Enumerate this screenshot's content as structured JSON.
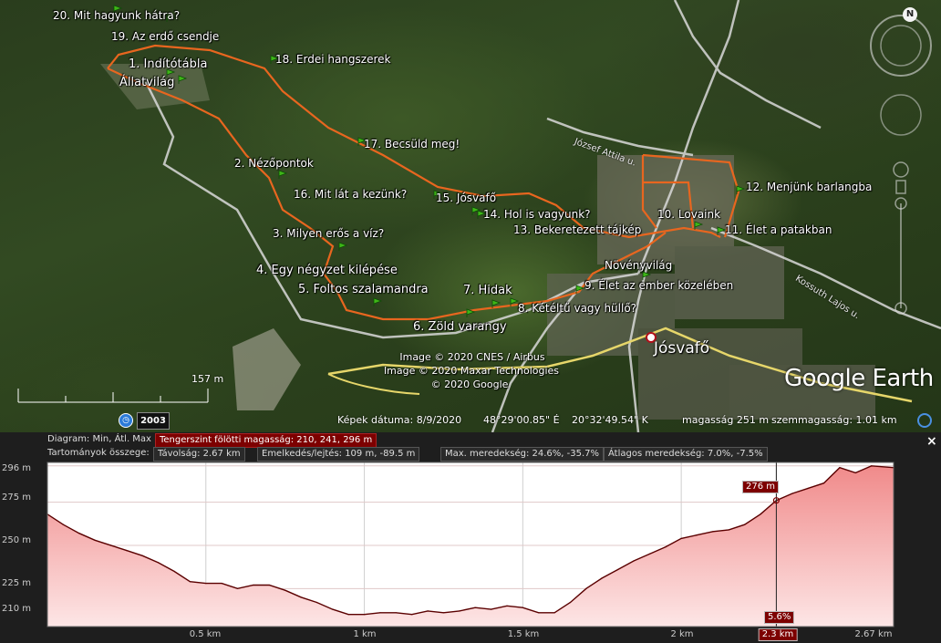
{
  "map": {
    "stations": [
      {
        "label": "20. Mit hagyunk hátra?"
      },
      {
        "label": "19. Az erdő csendje"
      },
      {
        "label": "1. Indítótábla"
      },
      {
        "label": "Állatvilág"
      },
      {
        "label": "18. Erdei hangszerek"
      },
      {
        "label": "17. Becsüld meg!"
      },
      {
        "label": "2. Nézőpontok"
      },
      {
        "label": "16. Mit lát a kezünk?"
      },
      {
        "label": "15. Jósvafő"
      },
      {
        "label": "14. Hol is vagyunk?"
      },
      {
        "label": "13. Bekeretezett tájkép"
      },
      {
        "label": "3. Milyen erős a víz?"
      },
      {
        "label": "4. Egy négyzet kilépése"
      },
      {
        "label": "5. Foltos szalamandra"
      },
      {
        "label": "7. Hidak"
      },
      {
        "label": "8. Kétéltű vagy hüllő?"
      },
      {
        "label": "6. Zöld varangy"
      },
      {
        "label": "Növényvilág"
      },
      {
        "label": "9. Élet az ember közelében"
      },
      {
        "label": "10. Lovaink"
      },
      {
        "label": "11. Élet a patakban"
      },
      {
        "label": "12. Menjünk barlangba"
      }
    ],
    "town": "Jósvafő",
    "roads": {
      "jozsef": "József Attila u.",
      "kossuth": "Kossuth Lajos u."
    },
    "credits": [
      "Image © 2020 CNES / Airbus",
      "Image © 2020 Maxar Technologies",
      "© 2020 Google"
    ],
    "logo": "Google Earth",
    "scale": "157 m",
    "year": "2003",
    "status": {
      "date": "Képek dátuma: 8/9/2020",
      "lat": "48°29'00.85\" É",
      "lon": "20°32'49.54\" K",
      "elev": "magasság   251 m",
      "eye": "szemmagasság:   1.01 km"
    },
    "compass": "N",
    "colors": {
      "track": "#e8661f",
      "road": "#d9d9d9",
      "main_road": "#e6d66a",
      "pin": "#3fb618"
    }
  },
  "profile": {
    "row1": {
      "label": "Diagram: Min, Átl. Max",
      "value": "Tengerszint fölötti magasság: 210, 241, 296 m"
    },
    "row2": {
      "label": "Tartományok összege:",
      "distance": "Távolság: 2.67 km",
      "gain": "Emelkedés/lejtés: 109 m, -89.5 m",
      "maxslope": "Max. meredekség: 24.6%, -35.7%",
      "avgslope": "Átlagos meredekség: 7.0%, -7.5%"
    },
    "cursor": {
      "elev": "276 m",
      "slope": "5.6%",
      "dist": "2.3 km"
    },
    "close": "×"
  },
  "chart_data": {
    "type": "area",
    "title": "Tengerszint fölötti magasság",
    "xlabel": "",
    "ylabel": "",
    "y_ticks": [
      "296 m",
      "275 m",
      "250 m",
      "225 m",
      "210 m"
    ],
    "x_ticks": [
      "0.5 km",
      "1 km",
      "1.5 km",
      "2 km",
      "2.3 km",
      "2.67 km"
    ],
    "xlim": [
      0,
      2.67
    ],
    "ylim": [
      203,
      298
    ],
    "colors": {
      "fill": "#f4b3b3",
      "line": "#5a0000"
    },
    "x": [
      0,
      0.05,
      0.1,
      0.15,
      0.2,
      0.25,
      0.3,
      0.35,
      0.4,
      0.45,
      0.5,
      0.55,
      0.6,
      0.65,
      0.7,
      0.75,
      0.8,
      0.85,
      0.9,
      0.95,
      1.0,
      1.05,
      1.1,
      1.15,
      1.2,
      1.25,
      1.3,
      1.35,
      1.4,
      1.45,
      1.5,
      1.55,
      1.6,
      1.65,
      1.7,
      1.75,
      1.8,
      1.85,
      1.9,
      1.95,
      2.0,
      2.05,
      2.1,
      2.15,
      2.2,
      2.25,
      2.3,
      2.35,
      2.4,
      2.45,
      2.5,
      2.55,
      2.6,
      2.67
    ],
    "y": [
      268,
      262,
      257,
      253,
      250,
      247,
      244,
      240,
      235,
      229,
      228,
      228,
      225,
      227,
      227,
      224,
      220,
      217,
      213,
      210,
      210,
      211,
      211,
      210,
      212,
      211,
      212,
      214,
      213,
      215,
      214,
      211,
      211,
      217,
      225,
      231,
      236,
      241,
      245,
      249,
      254,
      256,
      258,
      259,
      262,
      268,
      276,
      280,
      283,
      286,
      295,
      292,
      296,
      295
    ]
  }
}
